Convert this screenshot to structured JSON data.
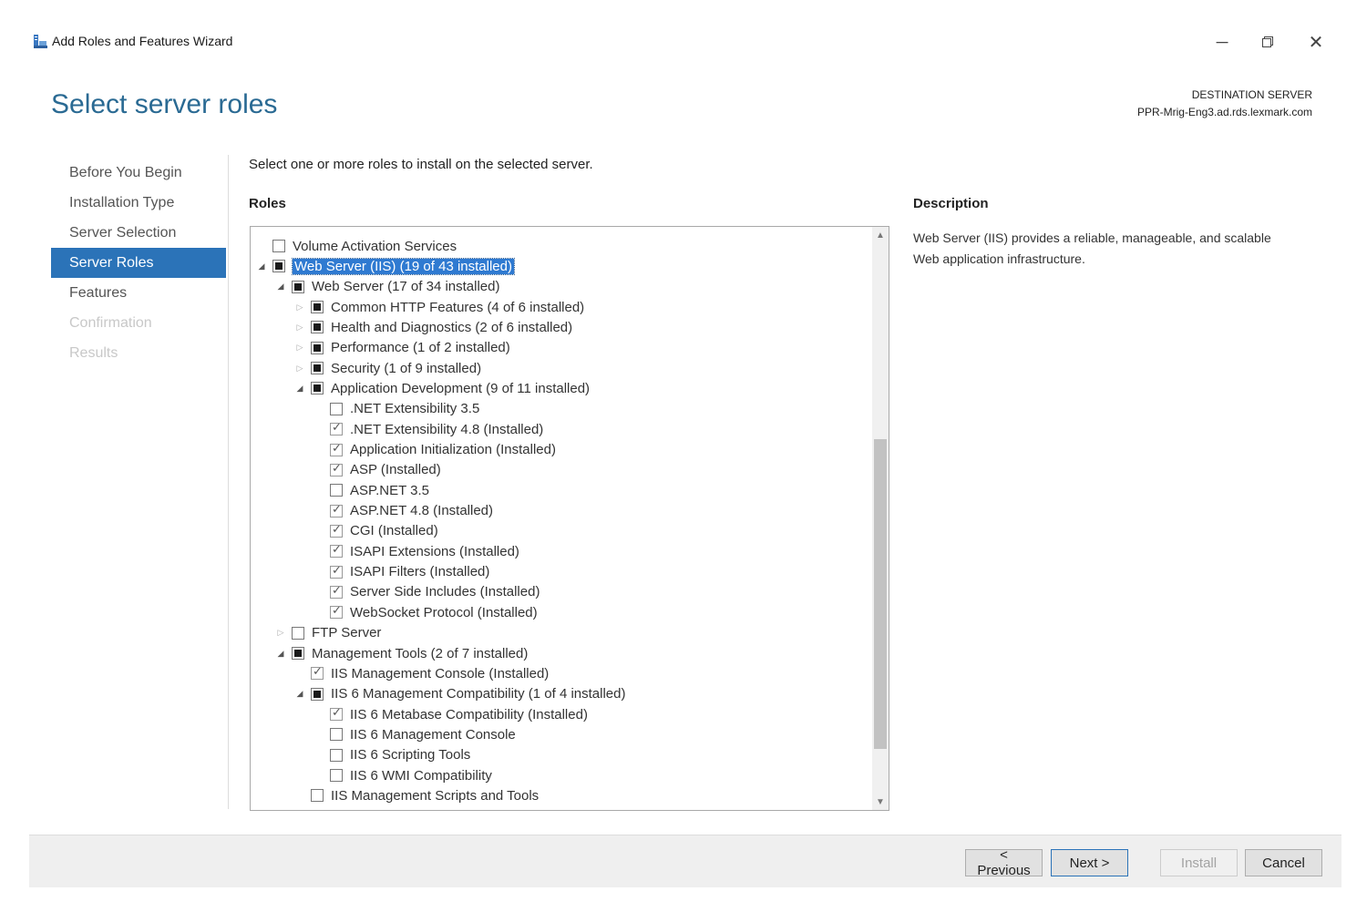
{
  "window": {
    "title": "Add Roles and Features Wizard"
  },
  "header": {
    "page_title": "Select server roles",
    "destination_label": "DESTINATION SERVER",
    "destination_server": "PPR-Mrig-Eng3.ad.rds.lexmark.com"
  },
  "nav": {
    "items": [
      {
        "label": "Before You Begin",
        "state": "normal"
      },
      {
        "label": "Installation Type",
        "state": "normal"
      },
      {
        "label": "Server Selection",
        "state": "normal"
      },
      {
        "label": "Server Roles",
        "state": "active"
      },
      {
        "label": "Features",
        "state": "normal"
      },
      {
        "label": "Confirmation",
        "state": "disabled"
      },
      {
        "label": "Results",
        "state": "disabled"
      }
    ]
  },
  "main": {
    "intro": "Select one or more roles to install on the selected server.",
    "roles_label": "Roles",
    "description_label": "Description",
    "description_text": "Web Server (IIS) provides a reliable, manageable, and scalable Web application infrastructure."
  },
  "roles_tree": [
    {
      "label": "Volume Activation Services",
      "level": 0,
      "expander": "none",
      "state": "unchecked"
    },
    {
      "label": "Web Server (IIS) (19 of 43 installed)",
      "level": 0,
      "expander": "expanded",
      "state": "partial",
      "selected": true
    },
    {
      "label": "Web Server (17 of 34 installed)",
      "level": 1,
      "expander": "expanded",
      "state": "partial"
    },
    {
      "label": "Common HTTP Features (4 of 6 installed)",
      "level": 2,
      "expander": "collapsed",
      "state": "partial"
    },
    {
      "label": "Health and Diagnostics (2 of 6 installed)",
      "level": 2,
      "expander": "collapsed",
      "state": "partial"
    },
    {
      "label": "Performance (1 of 2 installed)",
      "level": 2,
      "expander": "collapsed",
      "state": "partial"
    },
    {
      "label": "Security (1 of 9 installed)",
      "level": 2,
      "expander": "collapsed",
      "state": "partial"
    },
    {
      "label": "Application Development (9 of 11 installed)",
      "level": 2,
      "expander": "expanded",
      "state": "partial"
    },
    {
      "label": ".NET Extensibility 3.5",
      "level": 3,
      "expander": "none",
      "state": "unchecked"
    },
    {
      "label": ".NET Extensibility 4.8 (Installed)",
      "level": 3,
      "expander": "none",
      "state": "checked"
    },
    {
      "label": "Application Initialization (Installed)",
      "level": 3,
      "expander": "none",
      "state": "checked"
    },
    {
      "label": "ASP (Installed)",
      "level": 3,
      "expander": "none",
      "state": "checked"
    },
    {
      "label": "ASP.NET 3.5",
      "level": 3,
      "expander": "none",
      "state": "unchecked"
    },
    {
      "label": "ASP.NET 4.8 (Installed)",
      "level": 3,
      "expander": "none",
      "state": "checked"
    },
    {
      "label": "CGI (Installed)",
      "level": 3,
      "expander": "none",
      "state": "checked"
    },
    {
      "label": "ISAPI Extensions (Installed)",
      "level": 3,
      "expander": "none",
      "state": "checked"
    },
    {
      "label": "ISAPI Filters (Installed)",
      "level": 3,
      "expander": "none",
      "state": "checked"
    },
    {
      "label": "Server Side Includes (Installed)",
      "level": 3,
      "expander": "none",
      "state": "checked"
    },
    {
      "label": "WebSocket Protocol (Installed)",
      "level": 3,
      "expander": "none",
      "state": "checked"
    },
    {
      "label": "FTP Server",
      "level": 1,
      "expander": "collapsed",
      "state": "unchecked"
    },
    {
      "label": "Management Tools (2 of 7 installed)",
      "level": 1,
      "expander": "expanded",
      "state": "partial"
    },
    {
      "label": "IIS Management Console (Installed)",
      "level": 2,
      "expander": "none",
      "state": "checked"
    },
    {
      "label": "IIS 6 Management Compatibility (1 of 4 installed)",
      "level": 2,
      "expander": "expanded",
      "state": "partial"
    },
    {
      "label": "IIS 6 Metabase Compatibility (Installed)",
      "level": 3,
      "expander": "none",
      "state": "checked"
    },
    {
      "label": "IIS 6 Management Console",
      "level": 3,
      "expander": "none",
      "state": "unchecked"
    },
    {
      "label": "IIS 6 Scripting Tools",
      "level": 3,
      "expander": "none",
      "state": "unchecked"
    },
    {
      "label": "IIS 6 WMI Compatibility",
      "level": 3,
      "expander": "none",
      "state": "unchecked"
    },
    {
      "label": "IIS Management Scripts and Tools",
      "level": 2,
      "expander": "none",
      "state": "unchecked"
    }
  ],
  "footer": {
    "previous_label": "< Previous",
    "next_label": "Next >",
    "install_label": "Install",
    "cancel_label": "Cancel"
  },
  "colors": {
    "title_blue": "#2a6a93",
    "nav_active": "#2b73b8",
    "selection": "#2f7ad1"
  }
}
